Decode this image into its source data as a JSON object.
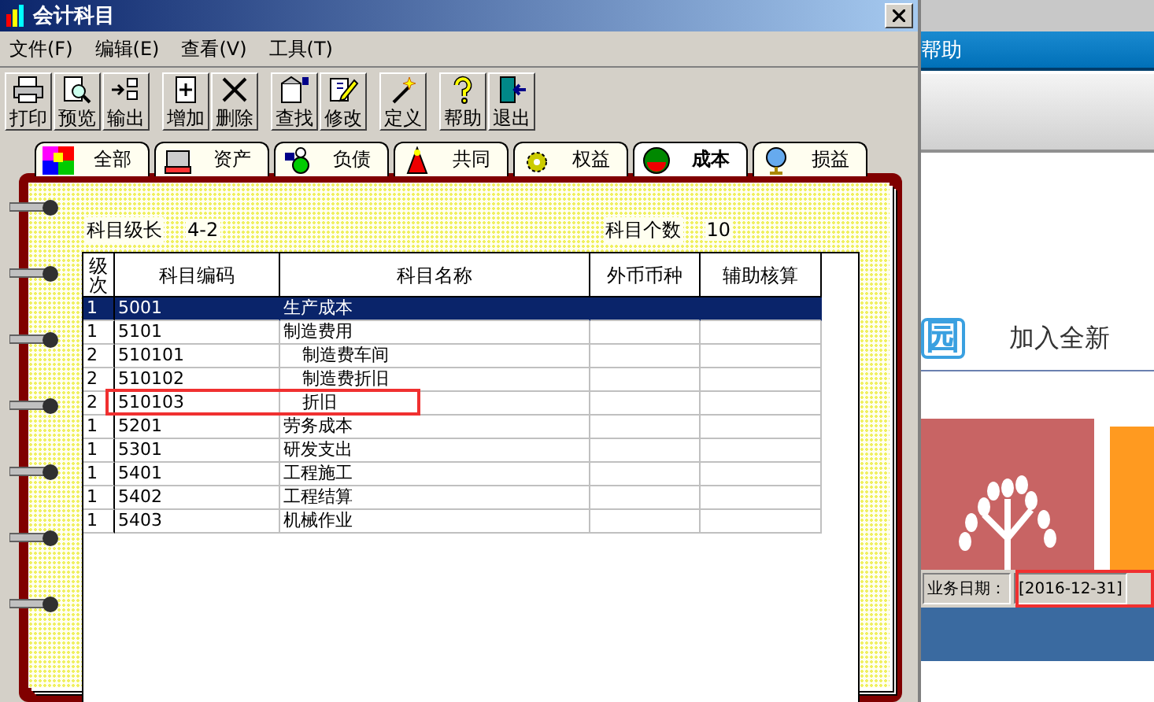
{
  "window": {
    "title": "会计科目"
  },
  "menu": [
    "文件(F)",
    "编辑(E)",
    "查看(V)",
    "工具(T)"
  ],
  "toolbar": [
    [
      "打印",
      "预览",
      "输出"
    ],
    [
      "增加",
      "删除"
    ],
    [
      "查找",
      "修改"
    ],
    [
      "定义"
    ],
    [
      "帮助",
      "退出"
    ]
  ],
  "tabs": [
    {
      "label": "全部",
      "selected": false
    },
    {
      "label": "资产",
      "selected": false
    },
    {
      "label": "负债",
      "selected": false
    },
    {
      "label": "共同",
      "selected": false
    },
    {
      "label": "权益",
      "selected": false
    },
    {
      "label": "成本",
      "selected": true
    },
    {
      "label": "损益",
      "selected": false
    }
  ],
  "summary": {
    "length_label": "科目级长",
    "length_value": "4-2",
    "count_label": "科目个数",
    "count_value": "10"
  },
  "table": {
    "columns": [
      "级次",
      "科目编码",
      "科目名称",
      "外币币种",
      "辅助核算"
    ],
    "rows": [
      {
        "level": "1",
        "code": "5001",
        "name": "生产成本",
        "selected": true
      },
      {
        "level": "1",
        "code": "5101",
        "name": "制造费用",
        "selected": false,
        "children": [
          {
            "level": "2",
            "code": "510101",
            "name": "制造费车间",
            "selected": false
          },
          {
            "level": "2",
            "code": "510102",
            "name": "制造费折旧",
            "selected": false
          },
          {
            "level": "2",
            "code": "510103",
            "name": "折旧",
            "selected": false
          }
        ]
      },
      {
        "level": "1",
        "code": "5201",
        "name": "劳务成本",
        "selected": false
      },
      {
        "level": "1",
        "code": "5301",
        "name": "研发支出",
        "selected": false
      },
      {
        "level": "1",
        "code": "5401",
        "name": "工程施工",
        "selected": false
      },
      {
        "level": "1",
        "code": "5402",
        "name": "工程结算",
        "selected": false
      },
      {
        "level": "1",
        "code": "5403",
        "name": "机械作业",
        "selected": false
      }
    ]
  },
  "background_app": {
    "menu_item": "帮助",
    "logo_text": "园",
    "banner_text": "加入全新",
    "status_label": "业务日期：",
    "status_date": "[2016-12-31]"
  }
}
